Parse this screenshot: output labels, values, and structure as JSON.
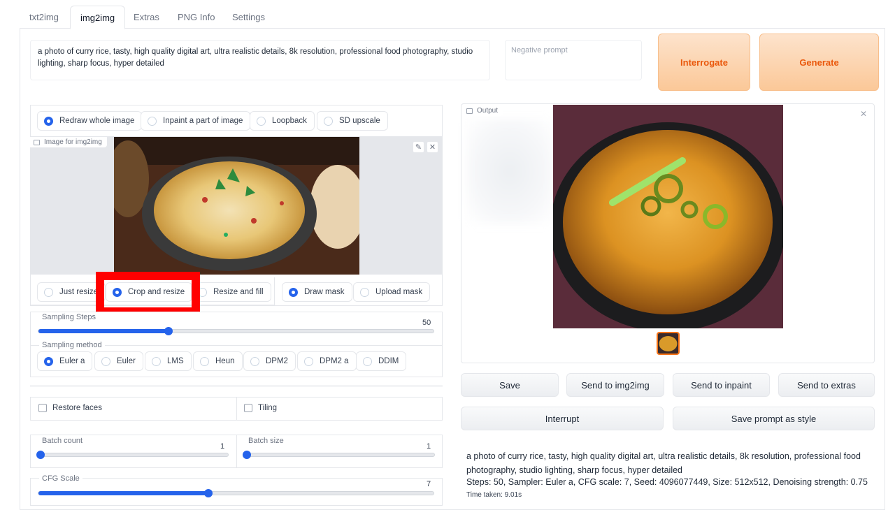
{
  "tabs": [
    {
      "label": "txt2img"
    },
    {
      "label": "img2img"
    },
    {
      "label": "Extras"
    },
    {
      "label": "PNG Info"
    },
    {
      "label": "Settings"
    }
  ],
  "prompt": {
    "value": "a photo of curry rice, tasty, high quality digital art, ultra realistic details, 8k resolution, professional food photography, studio lighting, sharp focus, hyper detailed",
    "negative_placeholder": "Negative prompt"
  },
  "buttons": {
    "interrogate": "Interrogate",
    "generate": "Generate"
  },
  "mode_radio": {
    "options": [
      "Redraw whole image",
      "Inpaint a part of image",
      "Loopback",
      "SD upscale"
    ],
    "selected": "Redraw whole image"
  },
  "image_input": {
    "label": "Image for img2img"
  },
  "resize_radio": {
    "options": [
      "Just resize",
      "Crop and resize",
      "Resize and fill"
    ],
    "selected": "Crop and resize"
  },
  "mask_radio": {
    "options": [
      "Draw mask",
      "Upload mask"
    ],
    "selected": "Draw mask"
  },
  "sampling_steps": {
    "label": "Sampling Steps",
    "value": "50",
    "fraction": 0.33
  },
  "sampling_method": {
    "label": "Sampling method",
    "options": [
      "Euler a",
      "Euler",
      "LMS",
      "Heun",
      "DPM2",
      "DPM2 a",
      "DDIM"
    ],
    "selected": "Euler a"
  },
  "restore_faces": {
    "label": "Restore faces",
    "checked": false
  },
  "tiling": {
    "label": "Tiling",
    "checked": false
  },
  "batch_count": {
    "label": "Batch count",
    "value": "1",
    "fraction": 0.0
  },
  "batch_size": {
    "label": "Batch size",
    "value": "1",
    "fraction": 0.0
  },
  "cfg_scale": {
    "label": "CFG Scale",
    "value": "7",
    "fraction": 0.43
  },
  "output": {
    "label": "Output",
    "buttons": [
      "Save",
      "Send to img2img",
      "Send to inpaint",
      "Send to extras"
    ],
    "interrupt": "Interrupt",
    "save_style": "Save prompt as style",
    "info_prompt": "a photo of curry rice, tasty, high quality digital art, ultra realistic details, 8k resolution, professional food photography, studio lighting, sharp focus, hyper detailed",
    "info_params": "Steps: 50, Sampler: Euler a, CFG scale: 7, Seed: 4096077449, Size: 512x512, Denoising strength: 0.75",
    "time_taken": "Time taken: 9.01s"
  },
  "colors": {
    "accent": "#2563eb",
    "generate_text": "#ea580c",
    "highlight": "#ff0000"
  }
}
